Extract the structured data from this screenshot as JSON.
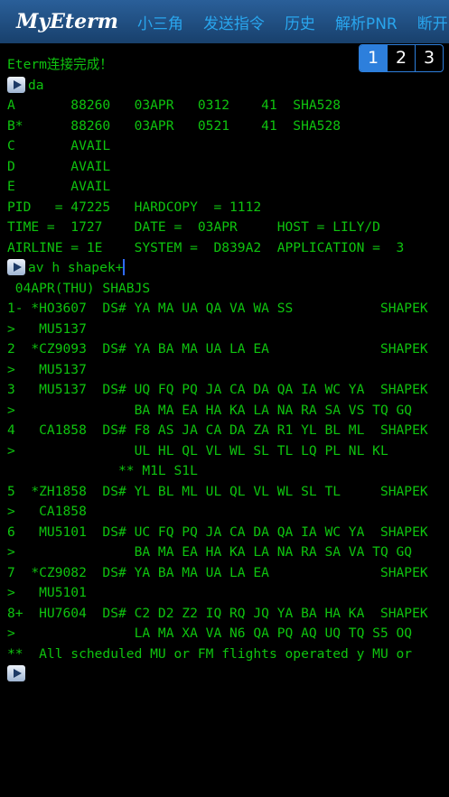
{
  "header": {
    "logo": "MyEterm",
    "nav": [
      "小三角",
      "发送指令",
      "历史",
      "解析PNR",
      "断开"
    ]
  },
  "pages": [
    "1",
    "2",
    "3"
  ],
  "terminal": {
    "status": "Eterm连接完成！",
    "command1": "da",
    "rows": [
      "A       88260   03APR   0312    41  SHA528",
      "B*      88260   03APR   0521    41  SHA528",
      "C       AVAIL",
      "D       AVAIL",
      "E       AVAIL",
      "PID   = 47225   HARDCOPY  = 1112",
      "TIME =  1727    DATE =  03APR     HOST = LILY/D",
      "AIRLINE = 1E    SYSTEM =  D839A2  APPLICATION =  3"
    ],
    "command2": "av h shapek+",
    "results": [
      " 04APR(THU) SHABJS",
      "1- *HO3607  DS# YA MA UA QA VA WA SS           SHAPEK",
      ">   MU5137",
      "2  *CZ9093  DS# YA BA MA UA LA EA              SHAPEK",
      ">   MU5137",
      "3   MU5137  DS# UQ FQ PQ JA CA DA QA IA WC YA  SHAPEK",
      ">               BA MA EA HA KA LA NA RA SA VS TQ GQ",
      "4   CA1858  DS# F8 AS JA CA DA ZA R1 YL BL ML  SHAPEK",
      ">               UL HL QL VL WL SL TL LQ PL NL KL",
      "              ** M1L S1L",
      "5  *ZH1858  DS# YL BL ML UL QL VL WL SL TL     SHAPEK",
      ">   CA1858",
      "6   MU5101  DS# UC FQ PQ JA CA DA QA IA WC YA  SHAPEK",
      ">               BA MA EA HA KA LA NA RA SA VA TQ GQ",
      "7  *CZ9082  DS# YA BA MA UA LA EA              SHAPEK",
      ">   MU5101",
      "8+  HU7604  DS# C2 D2 Z2 IQ RQ JQ YA BA HA KA  SHAPEK",
      ">               LA MA XA VA N6 QA PQ AQ UQ TQ S5 OQ",
      "**  All scheduled MU or FM flights operated y MU or"
    ]
  }
}
